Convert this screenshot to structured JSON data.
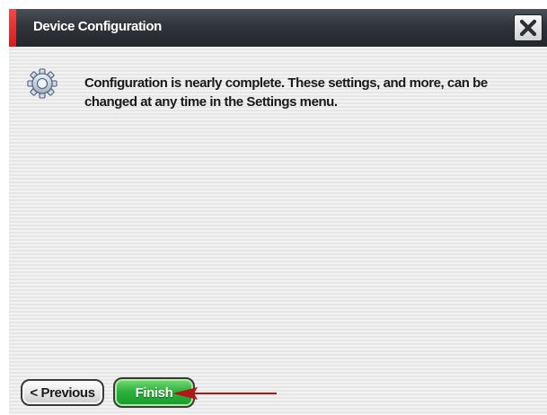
{
  "dialog": {
    "title": "Device Configuration",
    "close_icon": "close-x-icon",
    "message": "Configuration is nearly complete. These settings, and more, can be changed at any time in the Settings menu.",
    "message_icon": "gear-icon"
  },
  "buttons": {
    "previous_label": "< Previous",
    "finish_label": "Finish"
  },
  "annotation": {
    "arrow_icon": "pointer-arrow-icon"
  },
  "colors": {
    "accent": "#d21f1f",
    "titlebar": "#30353b",
    "finish_green": "#2fb23f",
    "arrow_red": "#b01818"
  }
}
